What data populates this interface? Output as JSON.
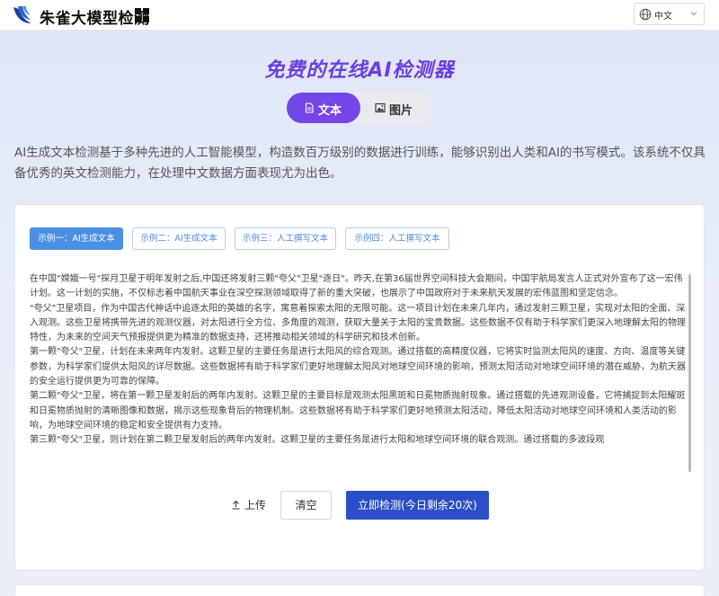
{
  "header": {
    "brand": "朱雀大模型检测",
    "language": "中文"
  },
  "hero": {
    "title": "免费的在线AI检测器",
    "tabs": [
      {
        "label": "文本",
        "active": true
      },
      {
        "label": "图片",
        "active": false
      }
    ],
    "intro": "AI生成文本检测基于多种先进的人工智能模型，构造数百万级别的数据进行训练，能够识别出人类和AI的书写模式。该系统不仅具备优秀的英文检测能力，在处理中文数据方面表现尤为出色。"
  },
  "examples": [
    {
      "label": "示例一：AI生成文本",
      "active": true
    },
    {
      "label": "示例二：AI生成文本",
      "active": false
    },
    {
      "label": "示例三：人工撰写文本",
      "active": false
    },
    {
      "label": "示例四：人工撰写文本",
      "active": false
    }
  ],
  "content": {
    "paragraphs": [
      "在中国\"嫦娥一号\"探月卫星于明年发射之后,中国还将发射三颗\"夸父\"卫星\"逐日\"。昨天,在第36届世界空间科技大会期间，中国宇航局发言人正式对外宣布了这一宏伟计划。这一计划的实施，不仅标志着中国航天事业在深空探测领域取得了新的重大突破，也展示了中国政府对于未来航天发展的宏伟蓝图和坚定信念。",
      "\"夸父\"卫星项目，作为中国古代神话中追逐太阳的英雄的名字，寓意着探索太阳的无限可能。这一项目计划在未来几年内，通过发射三颗卫星，实现对太阳的全面、深入观测。这些卫星将携带先进的观测仪器，对太阳进行全方位、多角度的观测，获取大量关于太阳的宝贵数据。这些数据不仅有助于科学家们更深入地理解太阳的物理特性，为未来的空间天气预报提供更为精准的数据支持，还将推动相关领域的科学研究和技术创新。",
      "第一颗\"夸父\"卫星，计划在未来两年内发射。这颗卫星的主要任务是进行太阳风的综合观测。通过搭载的高精度仪器，它将实时监测太阳风的速度、方向、温度等关键参数，为科学家们提供太阳风的详尽数据。这些数据将有助于科学家们更好地理解太阳风对地球空间环境的影响，预测太阳活动对地球空间环境的潜在威胁，为航天器的安全运行提供更为可靠的保障。",
      "第二颗\"夸父\"卫星，将在第一颗卫星发射后的两年内发射。这颗卫星的主要目标是观测太阳黑斑和日冕物质抛射现象。通过搭载的先进观测设备，它将捕捉到太阳耀斑和日冕物质抛射的清晰图像和数据，揭示这些现象背后的物理机制。这些数据将有助于科学家们更好地预测太阳活动，降低太阳活动对地球空间环境和人类活动的影响，为地球空间环境的稳定和安全提供有力支持。",
      "第三颗\"夸父\"卫星，则计划在第二颗卫星发射后的两年内发射。这颗卫星的主要任务是进行太阳和地球空间环境的联合观测。通过搭载的多波段观"
    ]
  },
  "actions": {
    "upload": "上传",
    "clear": "清空",
    "detect": "立即检测(今日剩余20次)"
  },
  "colors": {
    "accent_purple": "#7446e8",
    "title_purple": "#6a3fe0",
    "primary_blue": "#2a4fc6",
    "example_blue": "#4a90e2"
  }
}
